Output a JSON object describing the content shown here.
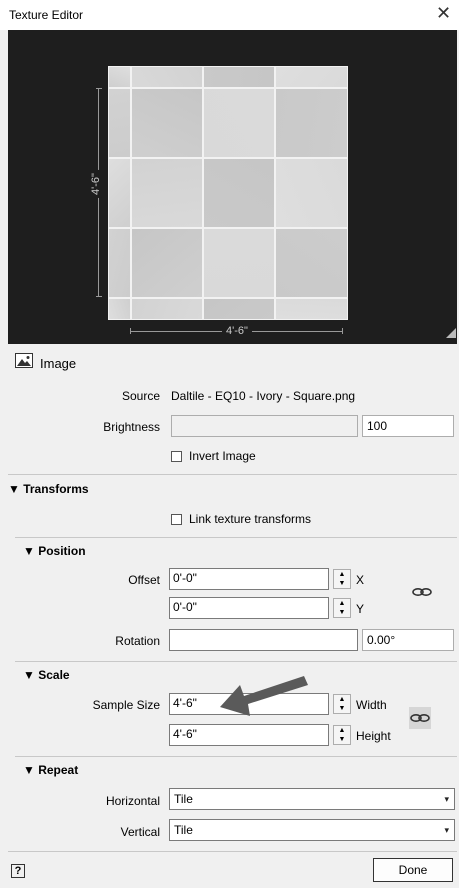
{
  "window": {
    "title": "Texture Editor",
    "close_glyph": "✕"
  },
  "preview": {
    "vertical_dimension": "4'-6\"",
    "horizontal_dimension": "4'-6\""
  },
  "image_section": {
    "title": "Image",
    "icon": "image-icon"
  },
  "source": {
    "label": "Source",
    "value": "Daltile - EQ10 - Ivory - Square.png"
  },
  "brightness": {
    "label": "Brightness",
    "value": "100"
  },
  "invert_image": {
    "label": "Invert Image",
    "checked": false
  },
  "transforms": {
    "title": "▼ Transforms",
    "link_label": "Link texture transforms",
    "link_checked": false
  },
  "position": {
    "title": "▼ Position",
    "offset_label": "Offset",
    "offset_x": "0'-0\"",
    "offset_y": "0'-0\"",
    "x_label": "X",
    "y_label": "Y",
    "rotation_label": "Rotation",
    "rotation_value": "0.00°"
  },
  "scale": {
    "title": "▼ Scale",
    "sample_size_label": "Sample Size",
    "width_value": "4'-6\"",
    "height_value": "4'-6\"",
    "width_label": "Width",
    "height_label": "Height"
  },
  "repeat": {
    "title": "▼ Repeat",
    "horizontal_label": "Horizontal",
    "horizontal_value": "Tile",
    "vertical_label": "Vertical",
    "vertical_value": "Tile"
  },
  "footer": {
    "help_glyph": "?",
    "done_label": "Done"
  },
  "colors": {
    "arrow": "#5a5a5a",
    "preview_bg": "#1e1e1e"
  }
}
